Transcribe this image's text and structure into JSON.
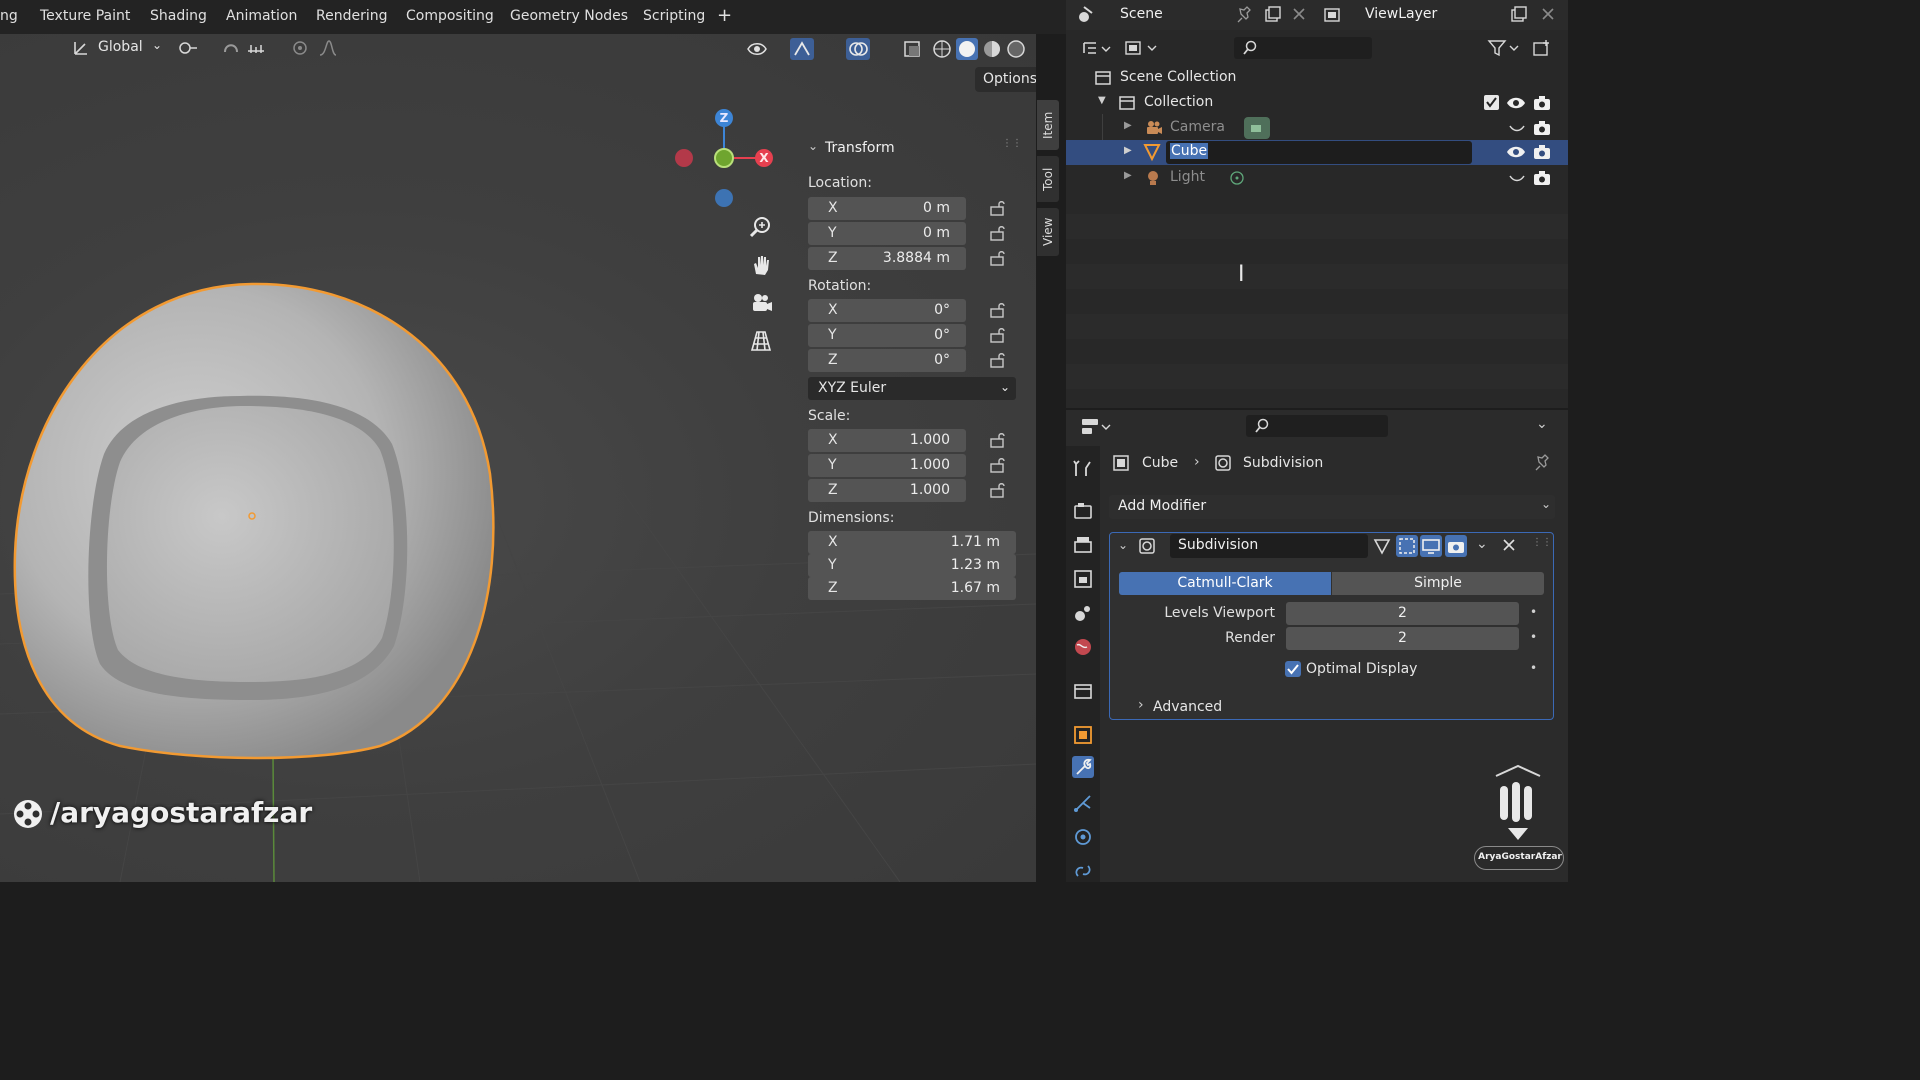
{
  "topbar": {
    "menus": [
      "ng",
      "Texture Paint",
      "Shading",
      "Animation",
      "Rendering",
      "Compositing",
      "Geometry Nodes",
      "Scripting",
      "+"
    ],
    "scene_label": "Scene",
    "view_layer_label": "ViewLayer"
  },
  "viewport_header": {
    "transform_orientation": "Global",
    "options_label": "Options"
  },
  "gizmo": {
    "z": "Z",
    "x": "X"
  },
  "n_panel": {
    "panel_title": "Transform",
    "location_label": "Location:",
    "location": [
      {
        "axis": "X",
        "value": "0 m"
      },
      {
        "axis": "Y",
        "value": "0 m"
      },
      {
        "axis": "Z",
        "value": "3.8884 m"
      }
    ],
    "rotation_label": "Rotation:",
    "rotation": [
      {
        "axis": "X",
        "value": "0°"
      },
      {
        "axis": "Y",
        "value": "0°"
      },
      {
        "axis": "Z",
        "value": "0°"
      }
    ],
    "rotation_mode": "XYZ Euler",
    "scale_label": "Scale:",
    "scale": [
      {
        "axis": "X",
        "value": "1.000"
      },
      {
        "axis": "Y",
        "value": "1.000"
      },
      {
        "axis": "Z",
        "value": "1.000"
      }
    ],
    "dimensions_label": "Dimensions:",
    "dimensions": [
      {
        "axis": "X",
        "value": "1.71 m"
      },
      {
        "axis": "Y",
        "value": "1.23 m"
      },
      {
        "axis": "Z",
        "value": "1.67 m"
      }
    ],
    "tabs": [
      "Item",
      "Tool",
      "View"
    ]
  },
  "outliner": {
    "scene_collection": "Scene Collection",
    "collection": "Collection",
    "items": [
      {
        "name": "Camera",
        "selected": false
      },
      {
        "name": "Cube",
        "selected": true
      },
      {
        "name": "Light",
        "selected": false
      }
    ]
  },
  "properties": {
    "breadcrumb_object": "Cube",
    "breadcrumb_modifier": "Subdivision",
    "add_modifier": "Add Modifier",
    "modifier_name": "Subdivision",
    "modes": [
      "Catmull-Clark",
      "Simple"
    ],
    "active_mode": "Catmull-Clark",
    "levels_viewport_label": "Levels Viewport",
    "levels_viewport": "2",
    "render_label": "Render",
    "render": "2",
    "optimal_display_label": "Optimal Display",
    "optimal_display": true,
    "advanced_label": "Advanced"
  },
  "watermark": {
    "handle": "/aryagostarafzar",
    "logo_text": "AryaGostarAfzar"
  },
  "colors": {
    "selection_outline": "#f29a32",
    "active_blue": "#4772b3",
    "axis_x": "#e6404f",
    "axis_y": "#8cc43a",
    "axis_z": "#3d85d6"
  }
}
